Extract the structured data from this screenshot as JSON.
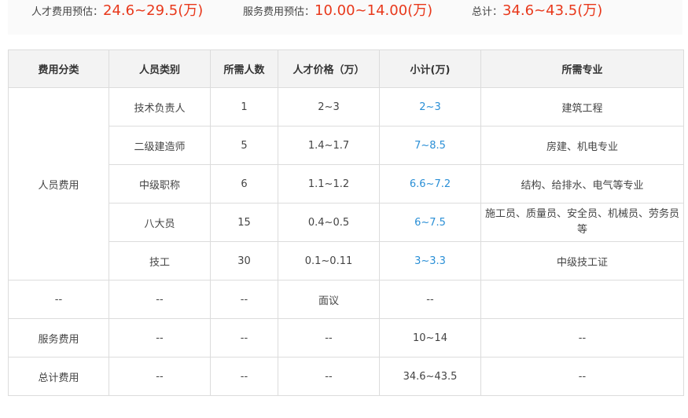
{
  "summary": {
    "talent_label": "人才费用预估：",
    "talent_value": "24.6~29.5(万)",
    "service_label": "服务费用预估：",
    "service_value": "10.00~14.00(万)",
    "total_label": "总计：",
    "total_value": "34.6~43.5(万)"
  },
  "table": {
    "headers": [
      "费用分类",
      "人员类别",
      "所需人数",
      "人才价格（万）",
      "小计(万)",
      "所需专业"
    ],
    "personnel_category": "人员费用",
    "personnel_rows": [
      {
        "type": "技术负责人",
        "count": "1",
        "price": "2~3",
        "subtotal": "2~3",
        "major": "建筑工程"
      },
      {
        "type": "二级建造师",
        "count": "5",
        "price": "1.4~1.7",
        "subtotal": "7~8.5",
        "major": "房建、机电专业"
      },
      {
        "type": "中级职称",
        "count": "6",
        "price": "1.1~1.2",
        "subtotal": "6.6~7.2",
        "major": "结构、给排水、电气等专业"
      },
      {
        "type": "八大员",
        "count": "15",
        "price": "0.4~0.5",
        "subtotal": "6~7.5",
        "major": "施工员、质量员、安全员、机械员、劳务员等"
      },
      {
        "type": "技工",
        "count": "30",
        "price": "0.1~0.11",
        "subtotal": "3~3.3",
        "major": "中级技工证"
      }
    ],
    "negotiable_row": {
      "category": "--",
      "type": "--",
      "count": "--",
      "price": "面议",
      "subtotal": "--",
      "major": ""
    },
    "service_row": {
      "category": "服务费用",
      "type": "--",
      "count": "--",
      "price": "--",
      "subtotal": "10~14",
      "major": "--"
    },
    "total_row": {
      "category": "总计费用",
      "type": "--",
      "count": "--",
      "price": "--",
      "subtotal": "34.6~43.5",
      "major": "--"
    }
  },
  "colors": {
    "accent_red": "#e8381b",
    "subtotal_blue": "#2a8fd6",
    "header_bg": "#f3f3f3",
    "border": "#dcdcdc"
  }
}
